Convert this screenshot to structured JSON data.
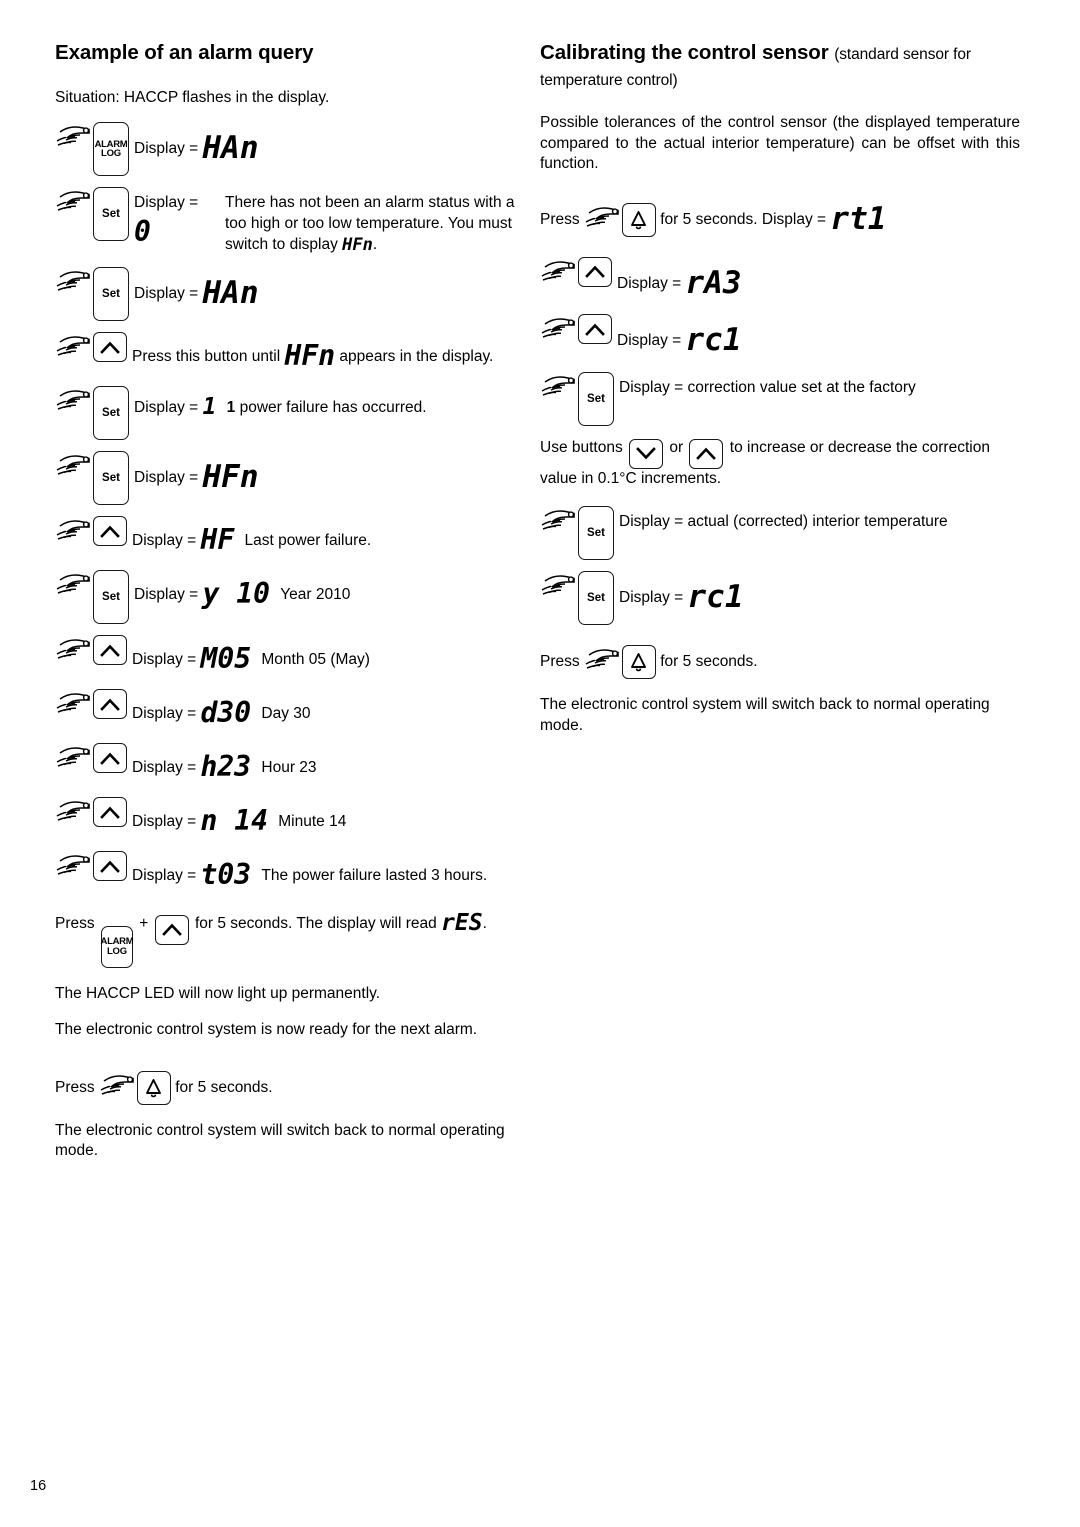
{
  "page": {
    "number": "16"
  },
  "left_column": {
    "title": "Example of an alarm query",
    "intro": "Situation: HACCP flashes in the display.",
    "steps": [
      {
        "button": "ALARM LOG",
        "label": "Display =",
        "lcd": "HAn",
        "note": ""
      },
      {
        "button": "Set",
        "label": "Display =",
        "lcd": "0",
        "note": "There has not been an alarm status with a too high or too low temperature. You must switch to display",
        "note_lcd": "HFn",
        "note_tail": "."
      },
      {
        "button": "Set",
        "label": "Display =",
        "lcd": "HAn",
        "note": ""
      },
      {
        "button": "up",
        "label_pre": "Press this button until",
        "lcd": "HFn",
        "label_post": "appears in the display."
      },
      {
        "button": "Set",
        "label": "Display =",
        "lcd": "1",
        "note_bold": "1",
        "note": "power failure has occurred."
      },
      {
        "button": "Set",
        "label": "Display =",
        "lcd": "HFn",
        "note": ""
      },
      {
        "button": "up",
        "label": "Display =",
        "lcd": "HF",
        "note": "Last power failure."
      },
      {
        "button": "Set",
        "label": "Display =",
        "lcd": "y 10",
        "note": "Year 2010"
      },
      {
        "button": "up",
        "label": "Display =",
        "lcd": "M05",
        "note": "Month 05 (May)"
      },
      {
        "button": "up",
        "label": "Display =",
        "lcd": "d30",
        "note": "Day 30"
      },
      {
        "button": "up",
        "label": "Display =",
        "lcd": "h23",
        "note": "Hour 23"
      },
      {
        "button": "up",
        "label": "Display =",
        "lcd": "n 14",
        "note": "Minute 14"
      },
      {
        "button": "up",
        "label": "Display =",
        "lcd": "t03",
        "note": "The power failure lasted 3 hours."
      }
    ],
    "reset_instruction": {
      "press_label": "Press",
      "button_1_line1": "ALARM",
      "button_1_line2": "LOG",
      "plus": "+",
      "button_2": "up",
      "duration_text": "for 5 seconds. The display will read",
      "lcd": "rES",
      "tail": "."
    },
    "after_reset_1": "The HACCP LED will now light up permanently.",
    "after_reset_2": "The electronic control system is now ready for the next alarm.",
    "exit_instruction": {
      "press_label": "Press",
      "button": "bell",
      "duration_text": "for 5 seconds."
    },
    "exit_result": "The electronic control system will switch back to normal operating mode."
  },
  "right_column": {
    "title_bold": "Calibrating the control sensor",
    "title_normal": "(standard sensor for temperature control)",
    "intro": "Possible tolerances of the control sensor (the displayed temperature compared to the actual interior temperature) can be offset with this function.",
    "enter_instruction": {
      "press_label": "Press",
      "button": "bell",
      "duration_text": "for 5 seconds. Display =",
      "lcd": "rt1"
    },
    "steps": [
      {
        "button": "up",
        "label": "Display =",
        "lcd": "rA3"
      },
      {
        "button": "up",
        "label": "Display =",
        "lcd": "rc1"
      },
      {
        "button": "Set",
        "label": "Display = correction value set at the factory",
        "lcd": ""
      }
    ],
    "adjust_instruction": {
      "pre": "Use buttons",
      "button_down": "down",
      "or": "or",
      "button_up": "up",
      "post": "to increase or decrease the correction value in 0.1°C increments."
    },
    "steps_2": [
      {
        "button": "Set",
        "label": "Display = actual (corrected) interior temperature",
        "lcd": ""
      },
      {
        "button": "Set",
        "label": "Display =",
        "lcd": "rc1"
      }
    ],
    "exit_instruction": {
      "press_label": "Press",
      "button": "bell",
      "duration_text": "for 5 seconds."
    },
    "exit_result": "The electronic control system will switch back to normal operating mode."
  },
  "colors": {
    "ink": "#000000",
    "paper": "#ffffff"
  }
}
